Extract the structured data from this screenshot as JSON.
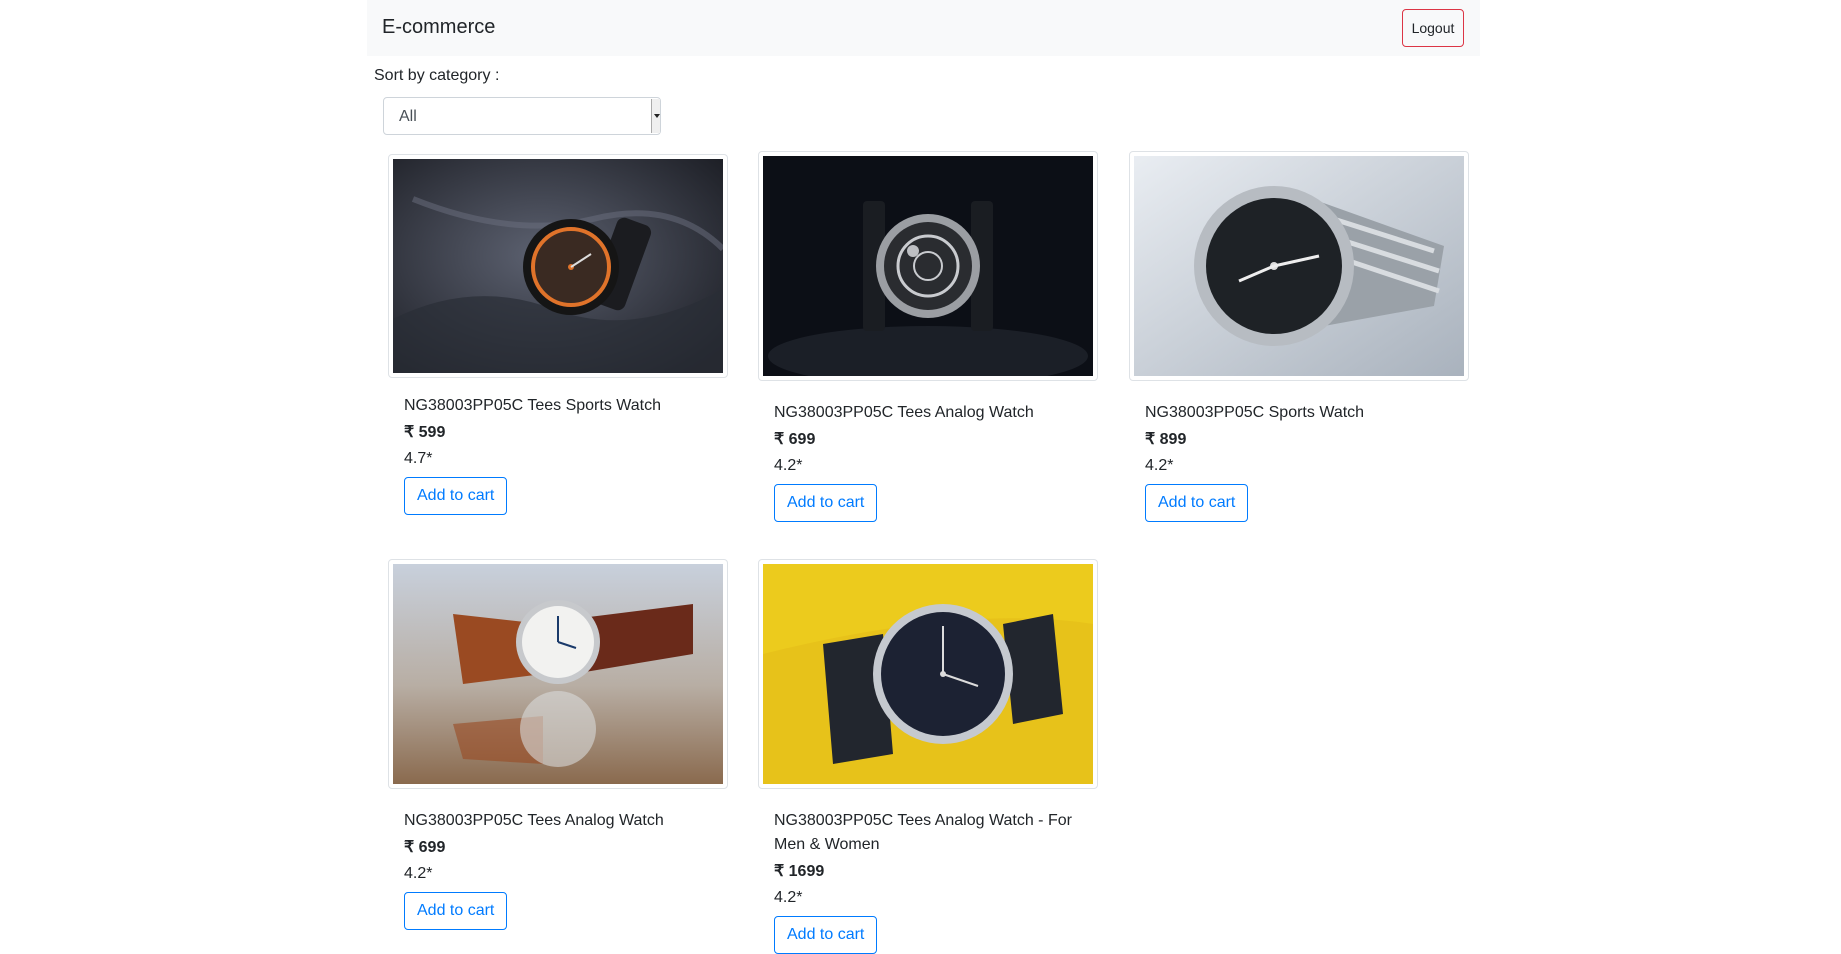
{
  "navbar": {
    "brand": "E-commerce",
    "logout_label": "Logout"
  },
  "filter": {
    "label": "Sort by category :",
    "selected": "All"
  },
  "currency_symbol": "₹",
  "products": [
    {
      "title": "NG38003PP05C Tees Sports Watch",
      "price": "599",
      "rating": "4.7*",
      "button": "Add to cart",
      "image": "sports-watch-on-dark-cloth"
    },
    {
      "title": "NG38003PP05C Tees Analog Watch",
      "price": "699",
      "rating": "4.2*",
      "button": "Add to cart",
      "image": "skeleton-watch-dark-background"
    },
    {
      "title": "NG38003PP05C Sports Watch",
      "price": "899",
      "rating": "4.2*",
      "button": "Add to cart",
      "image": "steel-chronograph-watch"
    },
    {
      "title": "NG38003PP05C Tees Analog Watch",
      "price": "699",
      "rating": "4.2*",
      "button": "Add to cart",
      "image": "leather-strap-white-dial-watch"
    },
    {
      "title": "NG38003PP05C Tees Analog Watch - For Men & Women",
      "price": "1699",
      "rating": "4.2*",
      "button": "Add to cart",
      "image": "blue-dial-watch-yellow-background"
    }
  ]
}
